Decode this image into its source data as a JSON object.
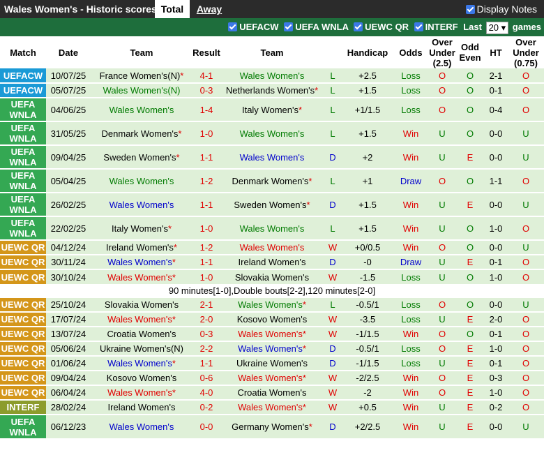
{
  "header": {
    "title": "Wales Women's - Historic scores",
    "tab_total": "Total",
    "tab_away": "Away",
    "display_notes": "Display Notes"
  },
  "filters": {
    "items": [
      "UEFACW",
      "UEFA WNLA",
      "UEWC QR",
      "INTERF"
    ],
    "last_label": "Last",
    "last_value": "20",
    "games_label": "games"
  },
  "columns": [
    "Match",
    "Date",
    "Team",
    "Result",
    "Team",
    "Handicap",
    "Odds",
    "Over Under (2.5)",
    "Odd Even",
    "HT",
    "Over Under (0.75)"
  ],
  "colors": {
    "UEFACW": "#1a9ad6",
    "UEFA WNLA": "#34a853",
    "UEWC QR": "#d4961a",
    "INTERF": "#8c9c2c"
  },
  "note": "90 minutes[1-0],Double bouts[2-2],120 minutes[2-0]",
  "rows": [
    {
      "match": "UEFACW",
      "date": "10/07/25",
      "home": "France Women's(N)",
      "home_star": true,
      "home_c": "black",
      "score": "4-1",
      "away": "Wales Women's",
      "away_star": false,
      "away_c": "green",
      "res": "L",
      "hcp": "+2.5",
      "odds": "Loss",
      "ou": "O",
      "oe": "O",
      "ht": "2-1",
      "ou2": "O"
    },
    {
      "match": "UEFACW",
      "date": "05/07/25",
      "home": "Wales Women's(N)",
      "home_star": false,
      "home_c": "green",
      "score": "0-3",
      "away": "Netherlands Women's",
      "away_star": true,
      "away_c": "black",
      "res": "L",
      "hcp": "+1.5",
      "odds": "Loss",
      "ou": "O",
      "oe": "O",
      "ht": "0-1",
      "ou2": "O"
    },
    {
      "match": "UEFA WNLA",
      "date": "04/06/25",
      "home": "Wales Women's",
      "home_star": false,
      "home_c": "green",
      "score": "1-4",
      "away": "Italy Women's",
      "away_star": true,
      "away_c": "black",
      "res": "L",
      "hcp": "+1/1.5",
      "odds": "Loss",
      "ou": "O",
      "oe": "O",
      "ht": "0-4",
      "ou2": "O"
    },
    {
      "match": "UEFA WNLA",
      "date": "31/05/25",
      "home": "Denmark Women's",
      "home_star": true,
      "home_c": "black",
      "score": "1-0",
      "away": "Wales Women's",
      "away_star": false,
      "away_c": "green",
      "res": "L",
      "hcp": "+1.5",
      "odds": "Win",
      "ou": "U",
      "oe": "O",
      "ht": "0-0",
      "ou2": "U"
    },
    {
      "match": "UEFA WNLA",
      "date": "09/04/25",
      "home": "Sweden Women's",
      "home_star": true,
      "home_c": "black",
      "score": "1-1",
      "away": "Wales Women's",
      "away_star": false,
      "away_c": "blue",
      "res": "D",
      "hcp": "+2",
      "odds": "Win",
      "ou": "U",
      "oe": "E",
      "ht": "0-0",
      "ou2": "U"
    },
    {
      "match": "UEFA WNLA",
      "date": "05/04/25",
      "home": "Wales Women's",
      "home_star": false,
      "home_c": "green",
      "score": "1-2",
      "away": "Denmark Women's",
      "away_star": true,
      "away_c": "black",
      "res": "L",
      "hcp": "+1",
      "odds": "Draw",
      "ou": "O",
      "oe": "O",
      "ht": "1-1",
      "ou2": "O"
    },
    {
      "match": "UEFA WNLA",
      "date": "26/02/25",
      "home": "Wales Women's",
      "home_star": false,
      "home_c": "blue",
      "score": "1-1",
      "away": "Sweden Women's",
      "away_star": true,
      "away_c": "black",
      "res": "D",
      "hcp": "+1.5",
      "odds": "Win",
      "ou": "U",
      "oe": "E",
      "ht": "0-0",
      "ou2": "U"
    },
    {
      "match": "UEFA WNLA",
      "date": "22/02/25",
      "home": "Italy Women's",
      "home_star": true,
      "home_c": "black",
      "score": "1-0",
      "away": "Wales Women's",
      "away_star": false,
      "away_c": "green",
      "res": "L",
      "hcp": "+1.5",
      "odds": "Win",
      "ou": "U",
      "oe": "O",
      "ht": "1-0",
      "ou2": "O"
    },
    {
      "match": "UEWC QR",
      "date": "04/12/24",
      "home": "Ireland Women's",
      "home_star": true,
      "home_c": "black",
      "score": "1-2",
      "away": "Wales Women's",
      "away_star": false,
      "away_c": "red",
      "res": "W",
      "hcp": "+0/0.5",
      "odds": "Win",
      "ou": "O",
      "oe": "O",
      "ht": "0-0",
      "ou2": "U"
    },
    {
      "match": "UEWC QR",
      "date": "30/11/24",
      "home": "Wales Women's",
      "home_star": true,
      "home_c": "blue",
      "score": "1-1",
      "away": "Ireland Women's",
      "away_star": false,
      "away_c": "black",
      "res": "D",
      "hcp": "-0",
      "odds": "Draw",
      "ou": "U",
      "oe": "E",
      "ht": "0-1",
      "ou2": "O"
    },
    {
      "match": "UEWC QR",
      "date": "30/10/24",
      "home": "Wales Women's",
      "home_star": true,
      "home_c": "red",
      "score": "1-0",
      "away": "Slovakia Women's",
      "away_star": false,
      "away_c": "black",
      "res": "W",
      "hcp": "-1.5",
      "odds": "Loss",
      "ou": "U",
      "oe": "O",
      "ht": "1-0",
      "ou2": "O",
      "note_after": true
    },
    {
      "match": "UEWC QR",
      "date": "25/10/24",
      "home": "Slovakia Women's",
      "home_star": false,
      "home_c": "black",
      "score": "2-1",
      "away": "Wales Women's",
      "away_star": true,
      "away_c": "green",
      "res": "L",
      "hcp": "-0.5/1",
      "odds": "Loss",
      "ou": "O",
      "oe": "O",
      "ht": "0-0",
      "ou2": "U"
    },
    {
      "match": "UEWC QR",
      "date": "17/07/24",
      "home": "Wales Women's",
      "home_star": true,
      "home_c": "red",
      "score": "2-0",
      "away": "Kosovo Women's",
      "away_star": false,
      "away_c": "black",
      "res": "W",
      "hcp": "-3.5",
      "odds": "Loss",
      "ou": "U",
      "oe": "E",
      "ht": "2-0",
      "ou2": "O"
    },
    {
      "match": "UEWC QR",
      "date": "13/07/24",
      "home": "Croatia Women's",
      "home_star": false,
      "home_c": "black",
      "score": "0-3",
      "away": "Wales Women's",
      "away_star": true,
      "away_c": "red",
      "res": "W",
      "hcp": "-1/1.5",
      "odds": "Win",
      "ou": "O",
      "oe": "O",
      "ht": "0-1",
      "ou2": "O"
    },
    {
      "match": "UEWC QR",
      "date": "05/06/24",
      "home": "Ukraine Women's(N)",
      "home_star": false,
      "home_c": "black",
      "score": "2-2",
      "away": "Wales Women's",
      "away_star": true,
      "away_c": "blue",
      "res": "D",
      "hcp": "-0.5/1",
      "odds": "Loss",
      "ou": "O",
      "oe": "E",
      "ht": "1-0",
      "ou2": "O"
    },
    {
      "match": "UEWC QR",
      "date": "01/06/24",
      "home": "Wales Women's",
      "home_star": true,
      "home_c": "blue",
      "score": "1-1",
      "away": "Ukraine Women's",
      "away_star": false,
      "away_c": "black",
      "res": "D",
      "hcp": "-1/1.5",
      "odds": "Loss",
      "ou": "U",
      "oe": "E",
      "ht": "0-1",
      "ou2": "O"
    },
    {
      "match": "UEWC QR",
      "date": "09/04/24",
      "home": "Kosovo Women's",
      "home_star": false,
      "home_c": "black",
      "score": "0-6",
      "away": "Wales Women's",
      "away_star": true,
      "away_c": "red",
      "res": "W",
      "hcp": "-2/2.5",
      "odds": "Win",
      "ou": "O",
      "oe": "E",
      "ht": "0-3",
      "ou2": "O"
    },
    {
      "match": "UEWC QR",
      "date": "06/04/24",
      "home": "Wales Women's",
      "home_star": true,
      "home_c": "red",
      "score": "4-0",
      "away": "Croatia Women's",
      "away_star": false,
      "away_c": "black",
      "res": "W",
      "hcp": "-2",
      "odds": "Win",
      "ou": "O",
      "oe": "E",
      "ht": "1-0",
      "ou2": "O"
    },
    {
      "match": "INTERF",
      "date": "28/02/24",
      "home": "Ireland Women's",
      "home_star": false,
      "home_c": "black",
      "score": "0-2",
      "away": "Wales Women's",
      "away_star": true,
      "away_c": "red",
      "res": "W",
      "hcp": "+0.5",
      "odds": "Win",
      "ou": "U",
      "oe": "E",
      "ht": "0-2",
      "ou2": "O"
    },
    {
      "match": "UEFA WNLA",
      "date": "06/12/23",
      "home": "Wales Women's",
      "home_star": false,
      "home_c": "blue",
      "score": "0-0",
      "away": "Germany Women's",
      "away_star": true,
      "away_c": "black",
      "res": "D",
      "hcp": "+2/2.5",
      "odds": "Win",
      "ou": "U",
      "oe": "E",
      "ht": "0-0",
      "ou2": "U"
    }
  ]
}
